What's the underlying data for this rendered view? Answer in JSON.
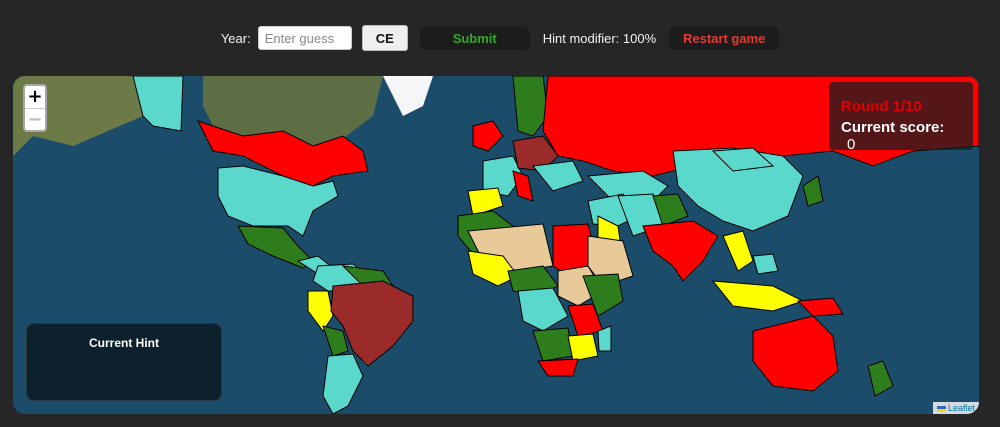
{
  "toolbar": {
    "year_label": "Year:",
    "year_input_placeholder": "Enter guess",
    "year_input_value": "",
    "era_button_label": "CE",
    "submit_label": "Submit",
    "hint_modifier_text": "Hint modifier: 100%",
    "restart_label": "Restart game"
  },
  "map": {
    "zoom_in_label": "+",
    "zoom_out_label": "−",
    "attribution_text": "Leaflet",
    "colors": {
      "ocean": "#1b4d6b",
      "red": "#ff0000",
      "turquoise": "#5ad8cc",
      "green": "#2e7d1c",
      "brown": "#9b2a2a",
      "yellow": "#ffff00",
      "desert": "#e8c99a",
      "land_imagery": "#6b7a46",
      "ice": "#f4f6f8"
    }
  },
  "score_panel": {
    "round_text": "Round 1/10",
    "score_label": "Current score:",
    "score_value": "0"
  },
  "hint_panel": {
    "title": "Current Hint",
    "text": ""
  }
}
